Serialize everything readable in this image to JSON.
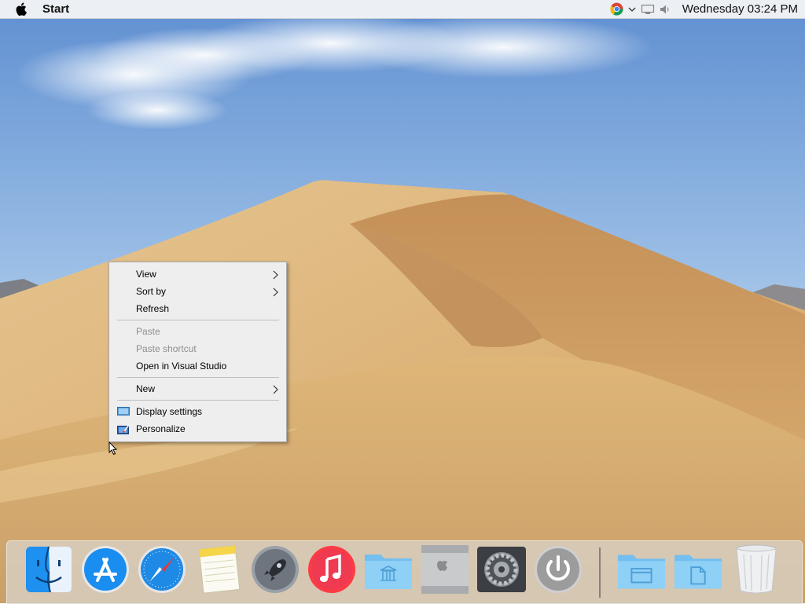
{
  "menubar": {
    "apple_icon": "apple-icon",
    "app_label": "Start",
    "tray_icons": [
      "chrome-icon",
      "chevron-down-icon",
      "network-icon",
      "volume-icon"
    ],
    "clock": "Wednesday 03:24 PM"
  },
  "context_menu": {
    "items": [
      {
        "label": "View",
        "submenu": true,
        "enabled": true
      },
      {
        "label": "Sort by",
        "submenu": true,
        "enabled": true
      },
      {
        "label": "Refresh",
        "enabled": true
      },
      {
        "label": "Paste",
        "enabled": false
      },
      {
        "label": "Paste shortcut",
        "enabled": false
      },
      {
        "label": "Open in Visual Studio",
        "enabled": true
      },
      {
        "label": "New",
        "submenu": true,
        "enabled": true
      },
      {
        "label": "Display settings",
        "icon": "display-settings-icon",
        "enabled": true
      },
      {
        "label": "Personalize",
        "icon": "personalize-icon",
        "enabled": true
      }
    ]
  },
  "dock": {
    "items": [
      "finder-icon",
      "app-store-icon",
      "safari-icon",
      "notes-icon",
      "launchpad-icon",
      "itunes-icon",
      "applications-folder-icon",
      "mac-pro-icon",
      "system-preferences-icon",
      "power-icon"
    ],
    "right_items": [
      "documents-folder-icon",
      "files-folder-icon",
      "trash-icon"
    ]
  },
  "colors": {
    "sky_top": "#6f9bd6",
    "sand": "#d9ae72",
    "menu_bg": "#eeeeee",
    "accent_blue": "#1e88f0"
  }
}
